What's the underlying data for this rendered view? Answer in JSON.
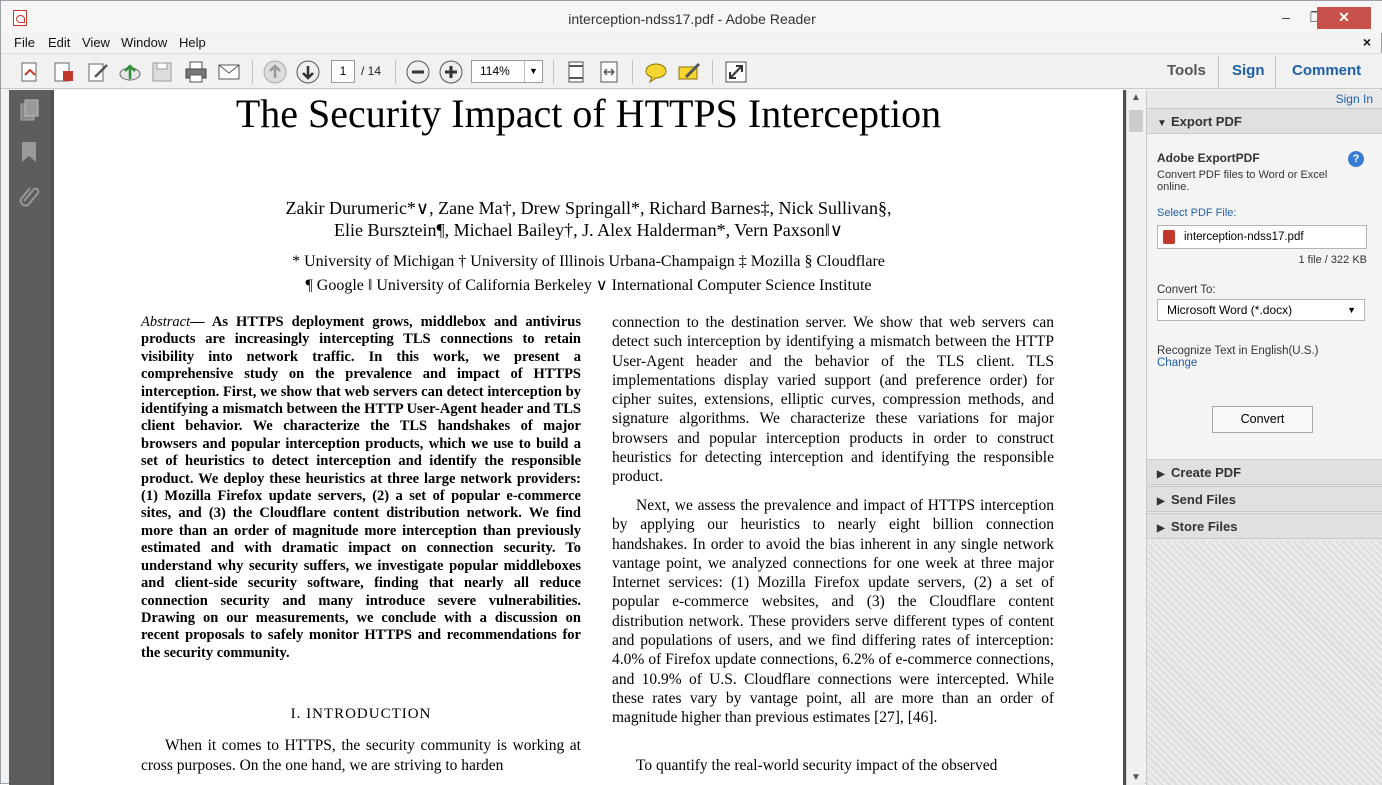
{
  "window": {
    "title": "interception-ndss17.pdf - Adobe Reader",
    "min": "–",
    "max": "❐",
    "close": "✕"
  },
  "menu": {
    "items": [
      "File",
      "Edit",
      "View",
      "Window",
      "Help"
    ],
    "close": "×"
  },
  "toolbar": {
    "page_current": "1",
    "page_total": "/ 14",
    "zoom": "114%",
    "tabs": {
      "tools": "Tools",
      "sign": "Sign",
      "comment": "Comment"
    },
    "icons": [
      "create-pdf-icon",
      "export-pdf-icon",
      "edit-pdf-icon",
      "upload-icon",
      "save-icon",
      "print-icon",
      "email-icon",
      "page-up-icon",
      "page-down-icon",
      "zoom-out-icon",
      "zoom-in-icon",
      "fit-page-icon",
      "fit-width-icon",
      "sticky-note-icon",
      "highlight-icon",
      "fullscreen-icon"
    ]
  },
  "document": {
    "title": "The Security Impact of HTTPS Interception",
    "authors_line1": "Zakir Durumeric*∨,   Zane Ma†,   Drew Springall*,   Richard Barnes‡,   Nick Sullivan§,",
    "authors_line2": "Elie Bursztein¶,   Michael Bailey†,   J. Alex Halderman*,    Vern Paxson‖∨",
    "affil_line1": "* University of Michigan   † University of Illinois Urbana-Champaign   ‡ Mozilla   § Cloudflare",
    "affil_line2": "¶ Google   ‖ University of California Berkeley   ∨ International Computer Science Institute",
    "abstract_label": "Abstract",
    "abstract_text": "— As HTTPS deployment grows, middlebox and antivirus products are increasingly intercepting TLS connections to retain visibility into network traffic. In this work, we present a comprehensive study on the prevalence and impact of HTTPS interception. First, we show that web servers can detect interception by identifying a mismatch between the HTTP User-Agent header and TLS client behavior. We characterize the TLS handshakes of major browsers and popular interception products, which we use to build a set of heuristics to detect interception and identify the responsible product. We deploy these heuristics at three large network providers: (1) Mozilla Firefox update servers, (2) a set of popular e-commerce sites, and (3) the Cloudflare content distribution network. We find more than an order of magnitude more interception than previously estimated and with dramatic impact on connection security. To understand why security suffers, we investigate popular middleboxes and client-side security software, finding that nearly all reduce connection security and many introduce severe vulnerabilities. Drawing on our measurements, we conclude with a discussion on recent proposals to safely monitor HTTPS and recommendations for the security community.",
    "section_heading": "I.   INTRODUCTION",
    "intro_text": "When it comes to HTTPS, the security community is working at cross purposes. On the one hand, we are striving to harden",
    "col2_p1": "connection to the destination server. We show that web servers can detect such interception by identifying a mismatch between the HTTP User-Agent header and the behavior of the TLS client. TLS implementations display varied support (and preference order) for cipher suites, extensions, elliptic curves, compression methods, and signature algorithms. We characterize these variations for major browsers and popular interception products in order to construct heuristics for detecting interception and identifying the responsible product.",
    "col2_p2": "Next, we assess the prevalence and impact of HTTPS interception by applying our heuristics to nearly eight billion connection handshakes. In order to avoid the bias inherent in any single network vantage point, we analyzed connections for one week at three major Internet services: (1) Mozilla Firefox update servers, (2) a set of popular e-commerce websites, and (3) the Cloudflare content distribution network. These providers serve different types of content and populations of users, and we find differing rates of interception: 4.0% of Firefox update connections, 6.2% of e-commerce connections, and 10.9% of U.S. Cloudflare connections were intercepted. While these rates vary by vantage point, all are more than an order of magnitude higher than previous estimates [27], [46].",
    "col2_p3": "To quantify the real-world security impact of the observed"
  },
  "panel": {
    "signin": "Sign In",
    "export_pdf": "Export PDF",
    "adobe_export": "Adobe ExportPDF",
    "export_desc": "Convert PDF files to Word or Excel online.",
    "select_file": "Select PDF File:",
    "file_name": "interception-ndss17.pdf",
    "file_info": "1 file / 322 KB",
    "convert_to": "Convert To:",
    "convert_option": "Microsoft Word (*.docx)",
    "recognize": "Recognize Text in English(U.S.)",
    "change": "Change",
    "convert_btn": "Convert",
    "create_pdf": "Create PDF",
    "send_files": "Send Files",
    "store_files": "Store Files"
  }
}
